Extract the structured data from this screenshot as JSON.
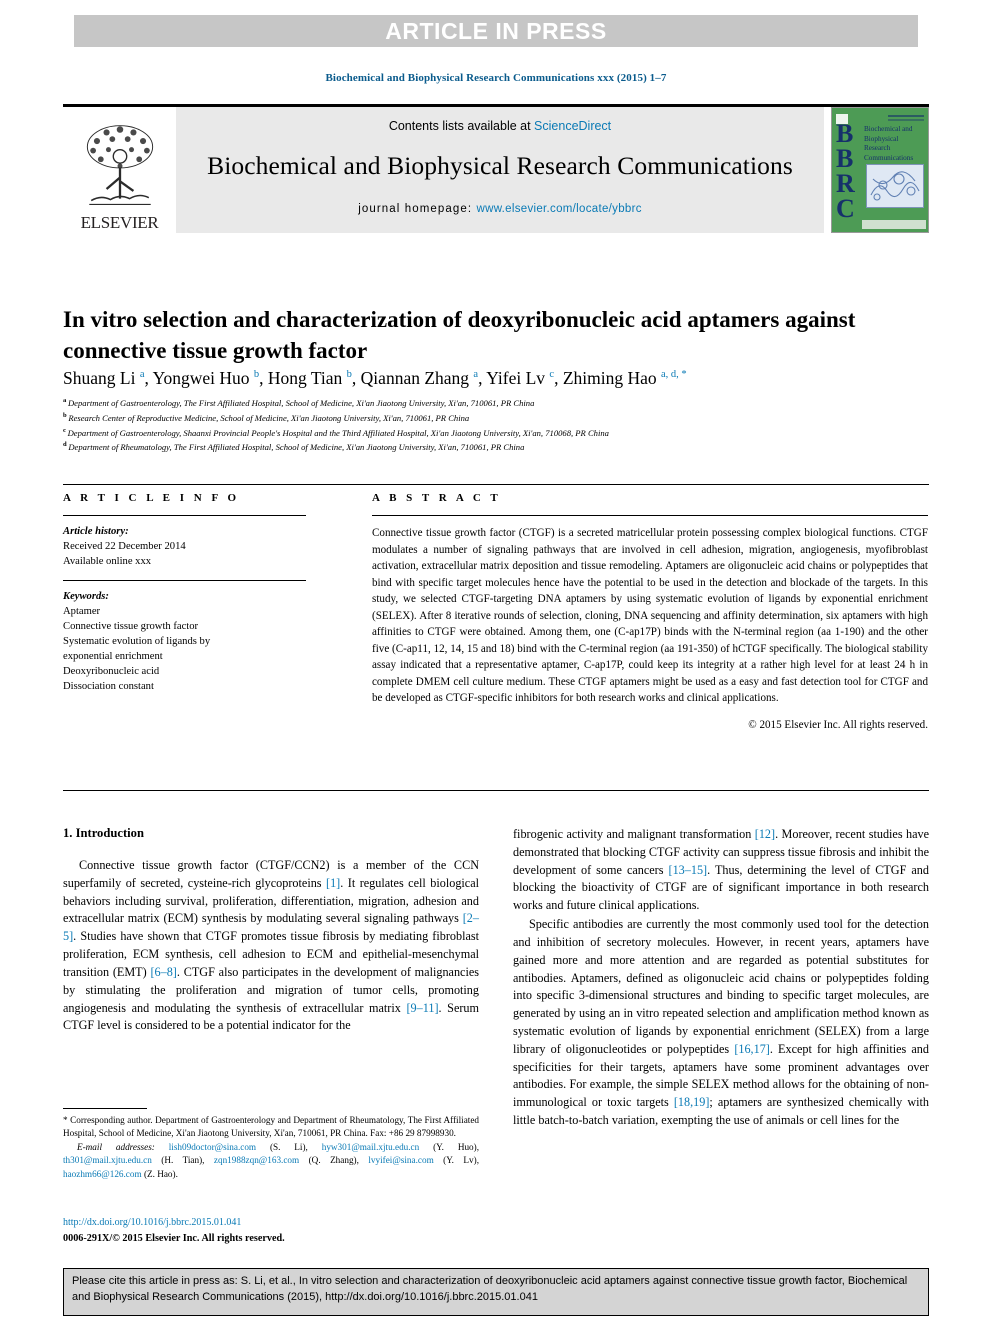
{
  "banner": {
    "label": "ARTICLE IN PRESS"
  },
  "runninghead": {
    "text": "Biochemical and Biophysical Research Communications xxx (2015) 1–7"
  },
  "masthead": {
    "contents_prefix": "Contents lists available at ",
    "sciencedirect": "ScienceDirect",
    "journal_title": "Biochemical and Biophysical Research Communications",
    "homepage_label": "journal homepage:",
    "homepage_url": "www.elsevier.com/locate/ybbrc",
    "publisher": "ELSEVIER",
    "cover_letters": "BBRC",
    "cover_journal_title": "Biochemical and Biophysical Research Communications",
    "link_color": "#0a7ab5"
  },
  "article": {
    "title": "In vitro selection and characterization of deoxyribonucleic acid aptamers against connective tissue growth factor",
    "authors": [
      {
        "name": "Shuang Li",
        "marks": "a"
      },
      {
        "name": "Yongwei Huo",
        "marks": "b"
      },
      {
        "name": "Hong Tian",
        "marks": "b"
      },
      {
        "name": "Qiannan Zhang",
        "marks": "a"
      },
      {
        "name": "Yifei Lv",
        "marks": "c"
      },
      {
        "name": "Zhiming Hao",
        "marks": "a, d, *"
      }
    ],
    "affiliations": [
      {
        "mark": "a",
        "text": "Department of Gastroenterology, The First Affiliated Hospital, School of Medicine, Xi'an Jiaotong University, Xi'an, 710061, PR China"
      },
      {
        "mark": "b",
        "text": "Research Center of Reproductive Medicine, School of Medicine, Xi'an Jiaotong University, Xi'an, 710061, PR China"
      },
      {
        "mark": "c",
        "text": "Department of Gastroenterology, Shaanxi Provincial People's Hospital and the Third Affiliated Hospital, Xi'an Jiaotong University, Xi'an, 710068, PR China"
      },
      {
        "mark": "d",
        "text": "Department of Rheumatology, The First Affiliated Hospital, School of Medicine, Xi'an Jiaotong University, Xi'an, 710061, PR China"
      }
    ]
  },
  "article_info": {
    "heading": "A R T I C L E   I N F O",
    "history_label": "Article history:",
    "history_lines": [
      "Received 22 December 2014",
      "Available online xxx"
    ],
    "keywords_label": "Keywords:",
    "keywords": [
      "Aptamer",
      "Connective tissue growth factor",
      "Systematic evolution of ligands by",
      "exponential enrichment",
      "Deoxyribonucleic acid",
      "Dissociation constant"
    ]
  },
  "abstract": {
    "heading": "A B S T R A C T",
    "body": "Connective tissue growth factor (CTGF) is a secreted matricellular protein possessing complex biological functions. CTGF modulates a number of signaling pathways that are involved in cell adhesion, migration, angiogenesis, myofibroblast activation, extracellular matrix deposition and tissue remodeling. Aptamers are oligonucleic acid chains or polypeptides that bind with specific target molecules hence have the potential to be used in the detection and blockade of the targets. In this study, we selected CTGF-targeting DNA aptamers by using systematic evolution of ligands by exponential enrichment (SELEX). After 8 iterative rounds of selection, cloning, DNA sequencing and affinity determination, six aptamers with high affinities to CTGF were obtained. Among them, one (C-ap17P) binds with the N-terminal region (aa 1-190) and the other five (C-ap11, 12, 14, 15 and 18) bind with the C-terminal region (aa 191-350) of hCTGF specifically. The biological stability assay indicated that a representative aptamer, C-ap17P, could keep its integrity at a rather high level for at least 24 h in complete DMEM cell culture medium. These CTGF aptamers might be used as a easy and fast detection tool for CTGF and be developed as CTGF-specific inhibitors for both research works and clinical applications.",
    "copyright": "© 2015 Elsevier Inc. All rights reserved."
  },
  "body": {
    "section_heading": "1. Introduction",
    "left_paragraphs": [
      "Connective tissue growth factor (CTGF/CCN2) is a member of the CCN superfamily of secreted, cysteine-rich glycoproteins [1]. It regulates cell biological behaviors including survival, proliferation, differentiation, migration, adhesion and extracellular matrix (ECM) synthesis by modulating several signaling pathways [2–5]. Studies have shown that CTGF promotes tissue fibrosis by mediating fibroblast proliferation, ECM synthesis, cell adhesion to ECM and epithelial-mesenchymal transition (EMT) [6–8]. CTGF also participates in the development of malignancies by stimulating the proliferation and migration of tumor cells, promoting angiogenesis and modulating the synthesis of extracellular matrix [9–11]. Serum CTGF level is considered to be a potential indicator for the"
    ],
    "right_paragraphs": [
      "fibrogenic activity and malignant transformation [12]. Moreover, recent studies have demonstrated that blocking CTGF activity can suppress tissue fibrosis and inhibit the development of some cancers [13–15]. Thus, determining the level of CTGF and blocking the bioactivity of CTGF are of significant importance in both research works and future clinical applications.",
      "Specific antibodies are currently the most commonly used tool for the detection and inhibition of secretory molecules. However, in recent years, aptamers have gained more and more attention and are regarded as potential substitutes for antibodies. Aptamers, defined as oligonucleic acid chains or polypeptides folding into specific 3-dimensional structures and binding to specific target molecules, are generated by using an in vitro repeated selection and amplification method known as systematic evolution of ligands by exponential enrichment (SELEX) from a large library of oligonucleotides or polypeptides [16,17]. Except for high affinities and specificities for their targets, aptamers have some prominent advantages over antibodies. For example, the simple SELEX method allows for the obtaining of non-immunological or toxic targets [18,19]; aptamers are synthesized chemically with little batch-to-batch variation, exempting the use of animals or cell lines for the"
    ]
  },
  "footnotes": {
    "corresponding": "* Corresponding author. Department of Gastroenterology and Department of Rheumatology, The First Affiliated Hospital, School of Medicine, Xi'an Jiaotong University, Xi'an, 710061, PR China. Fax: +86 29 87998930.",
    "email_label": "E-mail addresses:",
    "emails": [
      {
        "address": "lish09doctor@sina.com",
        "person": "(S. Li)"
      },
      {
        "address": "hyw301@mail.xjtu.edu.cn",
        "person": "(Y. Huo)"
      },
      {
        "address": "th301@mail.xjtu.edu.cn",
        "person": "(H. Tian)"
      },
      {
        "address": "zqn1988zqn@163.com",
        "person": "(Q. Zhang)"
      },
      {
        "address": "lvyifei@sina.com",
        "person": "(Y. Lv)"
      },
      {
        "address": "haozhm66@126.com",
        "person": "(Z. Hao)"
      }
    ],
    "doi_url": "http://dx.doi.org/10.1016/j.bbrc.2015.01.041",
    "issn_line": "0006-291X/© 2015 Elsevier Inc. All rights reserved."
  },
  "cite_box": {
    "text": "Please cite this article in press as: S. Li, et al., In vitro selection and characterization of deoxyribonucleic acid aptamers against connective tissue growth factor, Biochemical and Biophysical Research Communications (2015), http://dx.doi.org/10.1016/j.bbrc.2015.01.041"
  }
}
